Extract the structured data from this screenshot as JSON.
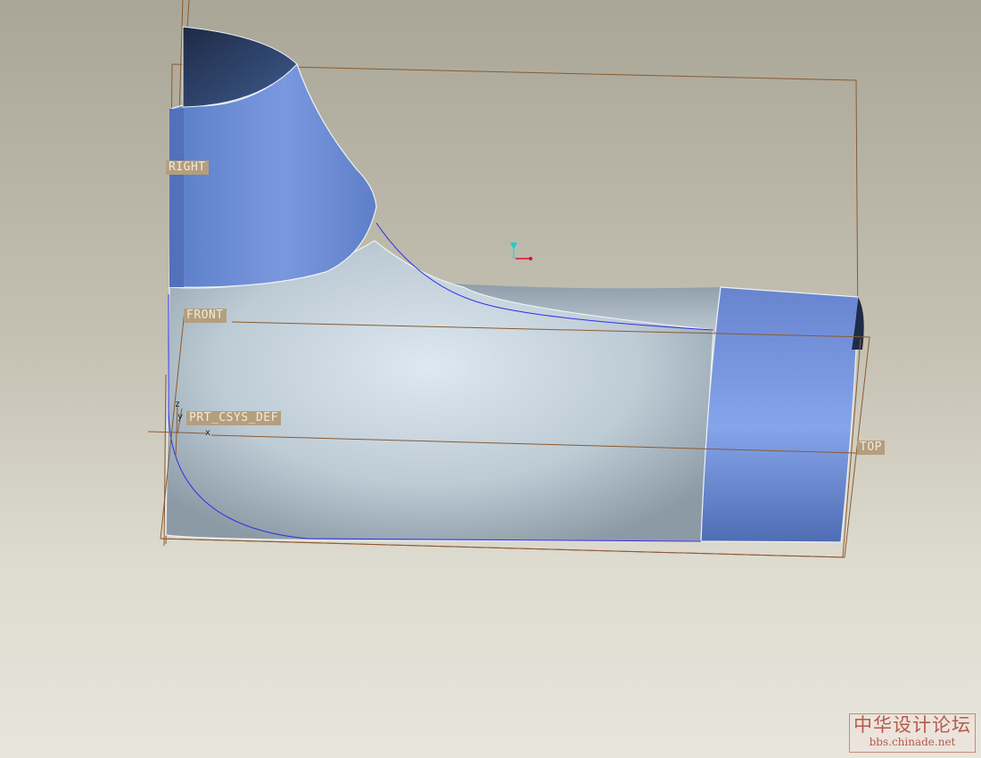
{
  "viewport": {
    "datum_planes": {
      "right": "RIGHT",
      "front": "FRONT",
      "top": "TOP"
    },
    "coordinate_system": {
      "name": "PRT_CSYS_DEF",
      "axis_x": "x",
      "axis_y": "y",
      "axis_z": "z"
    }
  },
  "watermark": {
    "chinese": "中华设计论坛",
    "url": "bbs.chinade.net"
  },
  "colors": {
    "background_top": "#a9a697",
    "background_bottom": "#e7e5dc",
    "datum_line": "#8c5a30",
    "surface_blue": "#6f8fd4",
    "surface_grey": "#c5d3dd",
    "edge_blue": "#3030e8"
  },
  "icons": {
    "spin_center": "spin-center-icon",
    "csys": "csys-icon"
  }
}
